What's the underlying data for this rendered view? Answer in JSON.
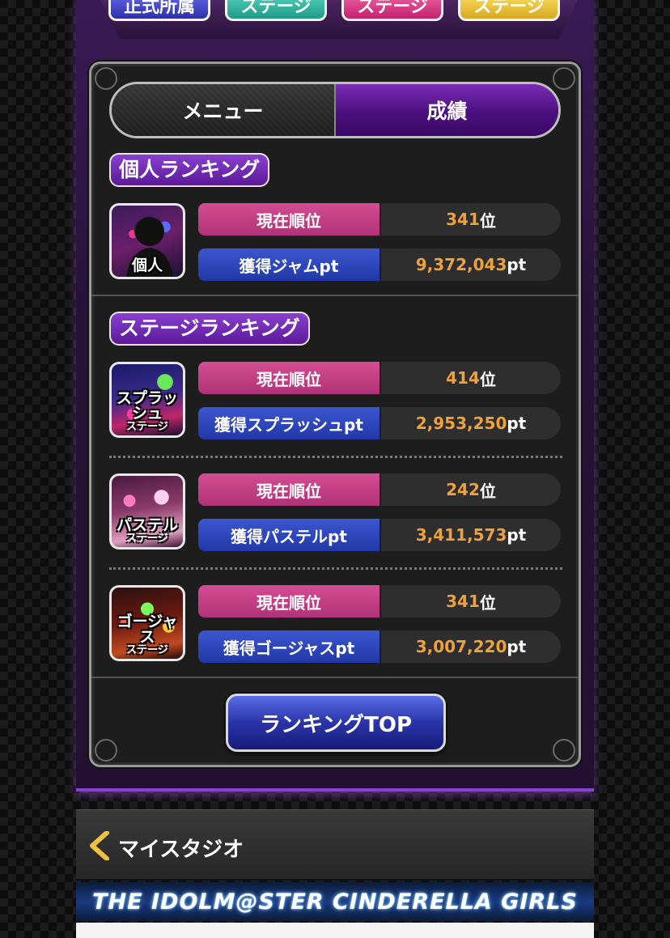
{
  "top_tabs": [
    {
      "label": "正式所属"
    },
    {
      "label": "ステージ"
    },
    {
      "label": "ステージ"
    },
    {
      "label": "ステージ"
    }
  ],
  "segmented": {
    "menu_label": "メニュー",
    "score_label": "成績",
    "selected": "成績"
  },
  "personal": {
    "section_title": "個人ランキング",
    "thumb_caption": "個人",
    "rank_label": "現在順位",
    "rank_value": "341",
    "rank_unit": "位",
    "pt_label": "獲得ジャムpt",
    "pt_value": "9,372,043",
    "pt_unit": "pt"
  },
  "stage": {
    "section_title": "ステージランキング",
    "items": [
      {
        "thumb_caption": "スプラッシュ",
        "thumb_sub": "ステージ",
        "rank_label": "現在順位",
        "rank_value": "414",
        "rank_unit": "位",
        "pt_label": "獲得スプラッシュpt",
        "pt_value": "2,953,250",
        "pt_unit": "pt"
      },
      {
        "thumb_caption": "パステル",
        "thumb_sub": "ステージ",
        "rank_label": "現在順位",
        "rank_value": "242",
        "rank_unit": "位",
        "pt_label": "獲得パステルpt",
        "pt_value": "3,411,573",
        "pt_unit": "pt"
      },
      {
        "thumb_caption": "ゴージャス",
        "thumb_sub": "ステージ",
        "rank_label": "現在順位",
        "rank_value": "341",
        "rank_unit": "位",
        "pt_label": "獲得ゴージャスpt",
        "pt_value": "3,007,220",
        "pt_unit": "pt"
      }
    ]
  },
  "ranking_top_button": "ランキングTOP",
  "nav": {
    "back_label": "マイスタジオ",
    "back_icon": "chevron-left-icon"
  },
  "footer_logo": "THE IDOLM@STER CINDERELLA GIRLS",
  "colors": {
    "accent_purple": "#7b2cb6",
    "rank_pink": "#d44d92",
    "pt_blue": "#3b56cf",
    "value_orange": "#f0a23a"
  }
}
